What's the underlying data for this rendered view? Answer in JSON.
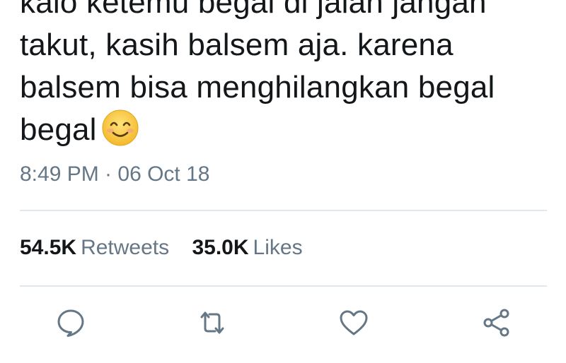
{
  "tweet": {
    "lines": [
      "kalo ketemu begal di jalan jangan",
      "takut, kasih balsem aja. karena",
      "balsem bisa menghilangkan begal",
      "begal"
    ],
    "emoji": "smiling-face-emoji",
    "timestamp": "8:49 PM · 06 Oct 18"
  },
  "stats": {
    "retweets_count": "54.5K",
    "retweets_label": "Retweets",
    "likes_count": "35.0K",
    "likes_label": "Likes"
  },
  "actions": {
    "reply_icon": "reply-icon",
    "retweet_icon": "retweet-icon",
    "like_icon": "heart-icon",
    "share_icon": "share-icon"
  },
  "colors": {
    "text": "#14171a",
    "secondary": "#657786",
    "divider": "#e1e8ed",
    "emoji_face": "#f7c948"
  }
}
